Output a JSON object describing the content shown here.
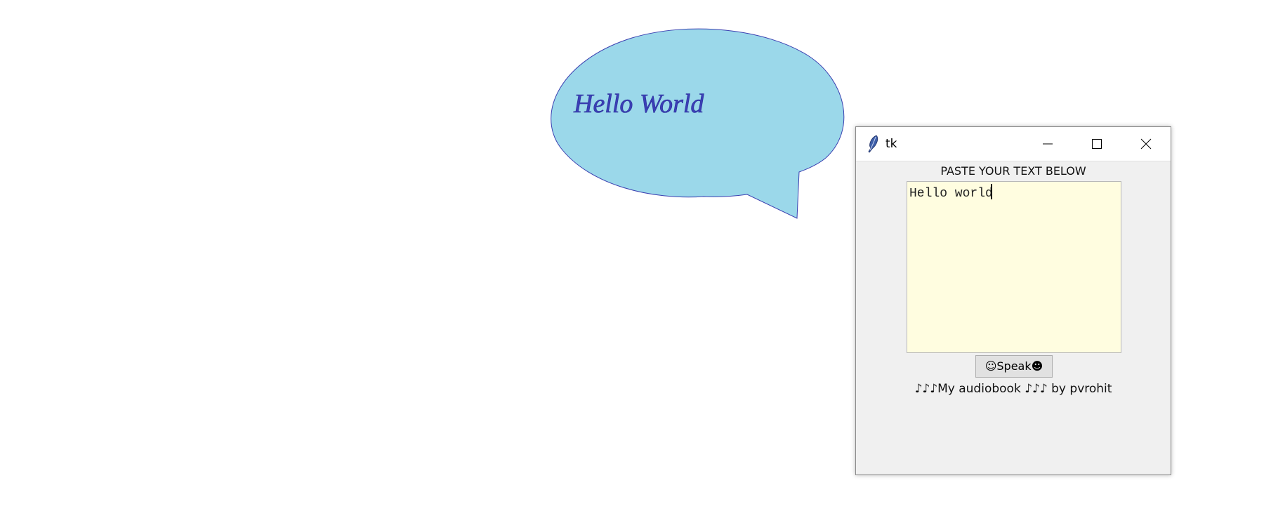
{
  "bubble": {
    "text": "Hello World",
    "fill_color": "#9bd8ea",
    "outline_color": "#3a3fb0",
    "text_color": "#3b3fb6"
  },
  "window": {
    "title": "tk",
    "icon": "feather-icon",
    "controls": {
      "minimize": "minimize-icon",
      "maximize": "maximize-icon",
      "close": "close-icon"
    },
    "heading": "PASTE YOUR TEXT BELOW",
    "textbox": {
      "value": "Hello world",
      "background": "#fffde0"
    },
    "speak_button": "☺Speak☻",
    "footer": "♪♪♪My audiobook ♪♪♪ by pvrohit"
  }
}
